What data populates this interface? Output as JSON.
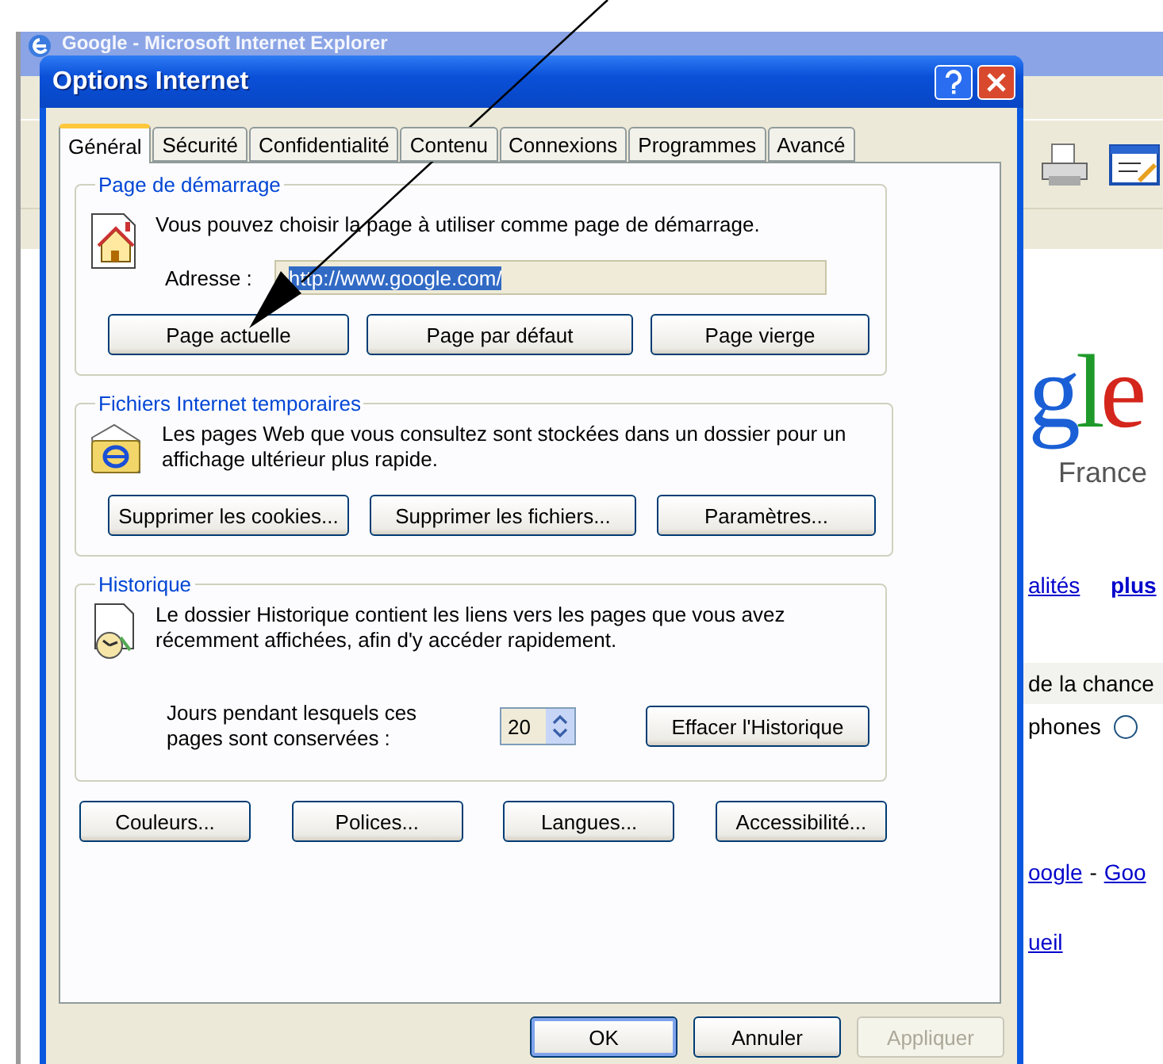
{
  "background_window": {
    "title": "Google - Microsoft Internet Explorer",
    "logo_text": "gle",
    "region": "France",
    "links": [
      "alités",
      "plus"
    ],
    "banner_text": "de la chance",
    "radio": {
      "label": "phones",
      "selected": false
    },
    "footer_links": [
      "oogle",
      "Goo"
    ],
    "footer_separator": "-",
    "home_link": "ueil"
  },
  "dialog": {
    "title": "Options Internet",
    "tabs": [
      {
        "label": "Général",
        "selected": true
      },
      {
        "label": "Sécurité",
        "selected": false
      },
      {
        "label": "Confidentialité",
        "selected": false
      },
      {
        "label": "Contenu",
        "selected": false
      },
      {
        "label": "Connexions",
        "selected": false
      },
      {
        "label": "Programmes",
        "selected": false
      },
      {
        "label": "Avancé",
        "selected": false
      }
    ],
    "home_page": {
      "title": "Page de démarrage",
      "text": "Vous pouvez choisir la page à utiliser comme page de démarrage.",
      "address_label": "Adresse :",
      "address_value": "http://www.google.com/",
      "address_selected": true,
      "buttons": [
        "Page actuelle",
        "Page par défaut",
        "Page vierge"
      ]
    },
    "temp_files": {
      "title": "Fichiers Internet temporaires",
      "text": "Les pages Web que vous consultez sont stockées dans un dossier pour un affichage ultérieur plus rapide.",
      "buttons": [
        "Supprimer les cookies...",
        "Supprimer les fichiers...",
        "Paramètres..."
      ]
    },
    "history": {
      "title": "Historique",
      "text": "Le dossier Historique contient les liens vers les pages que vous avez récemment affichées, afin d'y accéder rapidement.",
      "days_label": "Jours pendant lesquels ces pages sont conservées :",
      "days_value": "20",
      "button": "Effacer l'Historique"
    },
    "bottom_buttons": [
      "Couleurs...",
      "Polices...",
      "Langues...",
      "Accessibilité..."
    ],
    "dialog_buttons": [
      {
        "label": "OK",
        "default": true,
        "disabled": false
      },
      {
        "label": "Annuler",
        "default": false,
        "disabled": false
      },
      {
        "label": "Appliquer",
        "default": false,
        "disabled": true
      }
    ]
  }
}
